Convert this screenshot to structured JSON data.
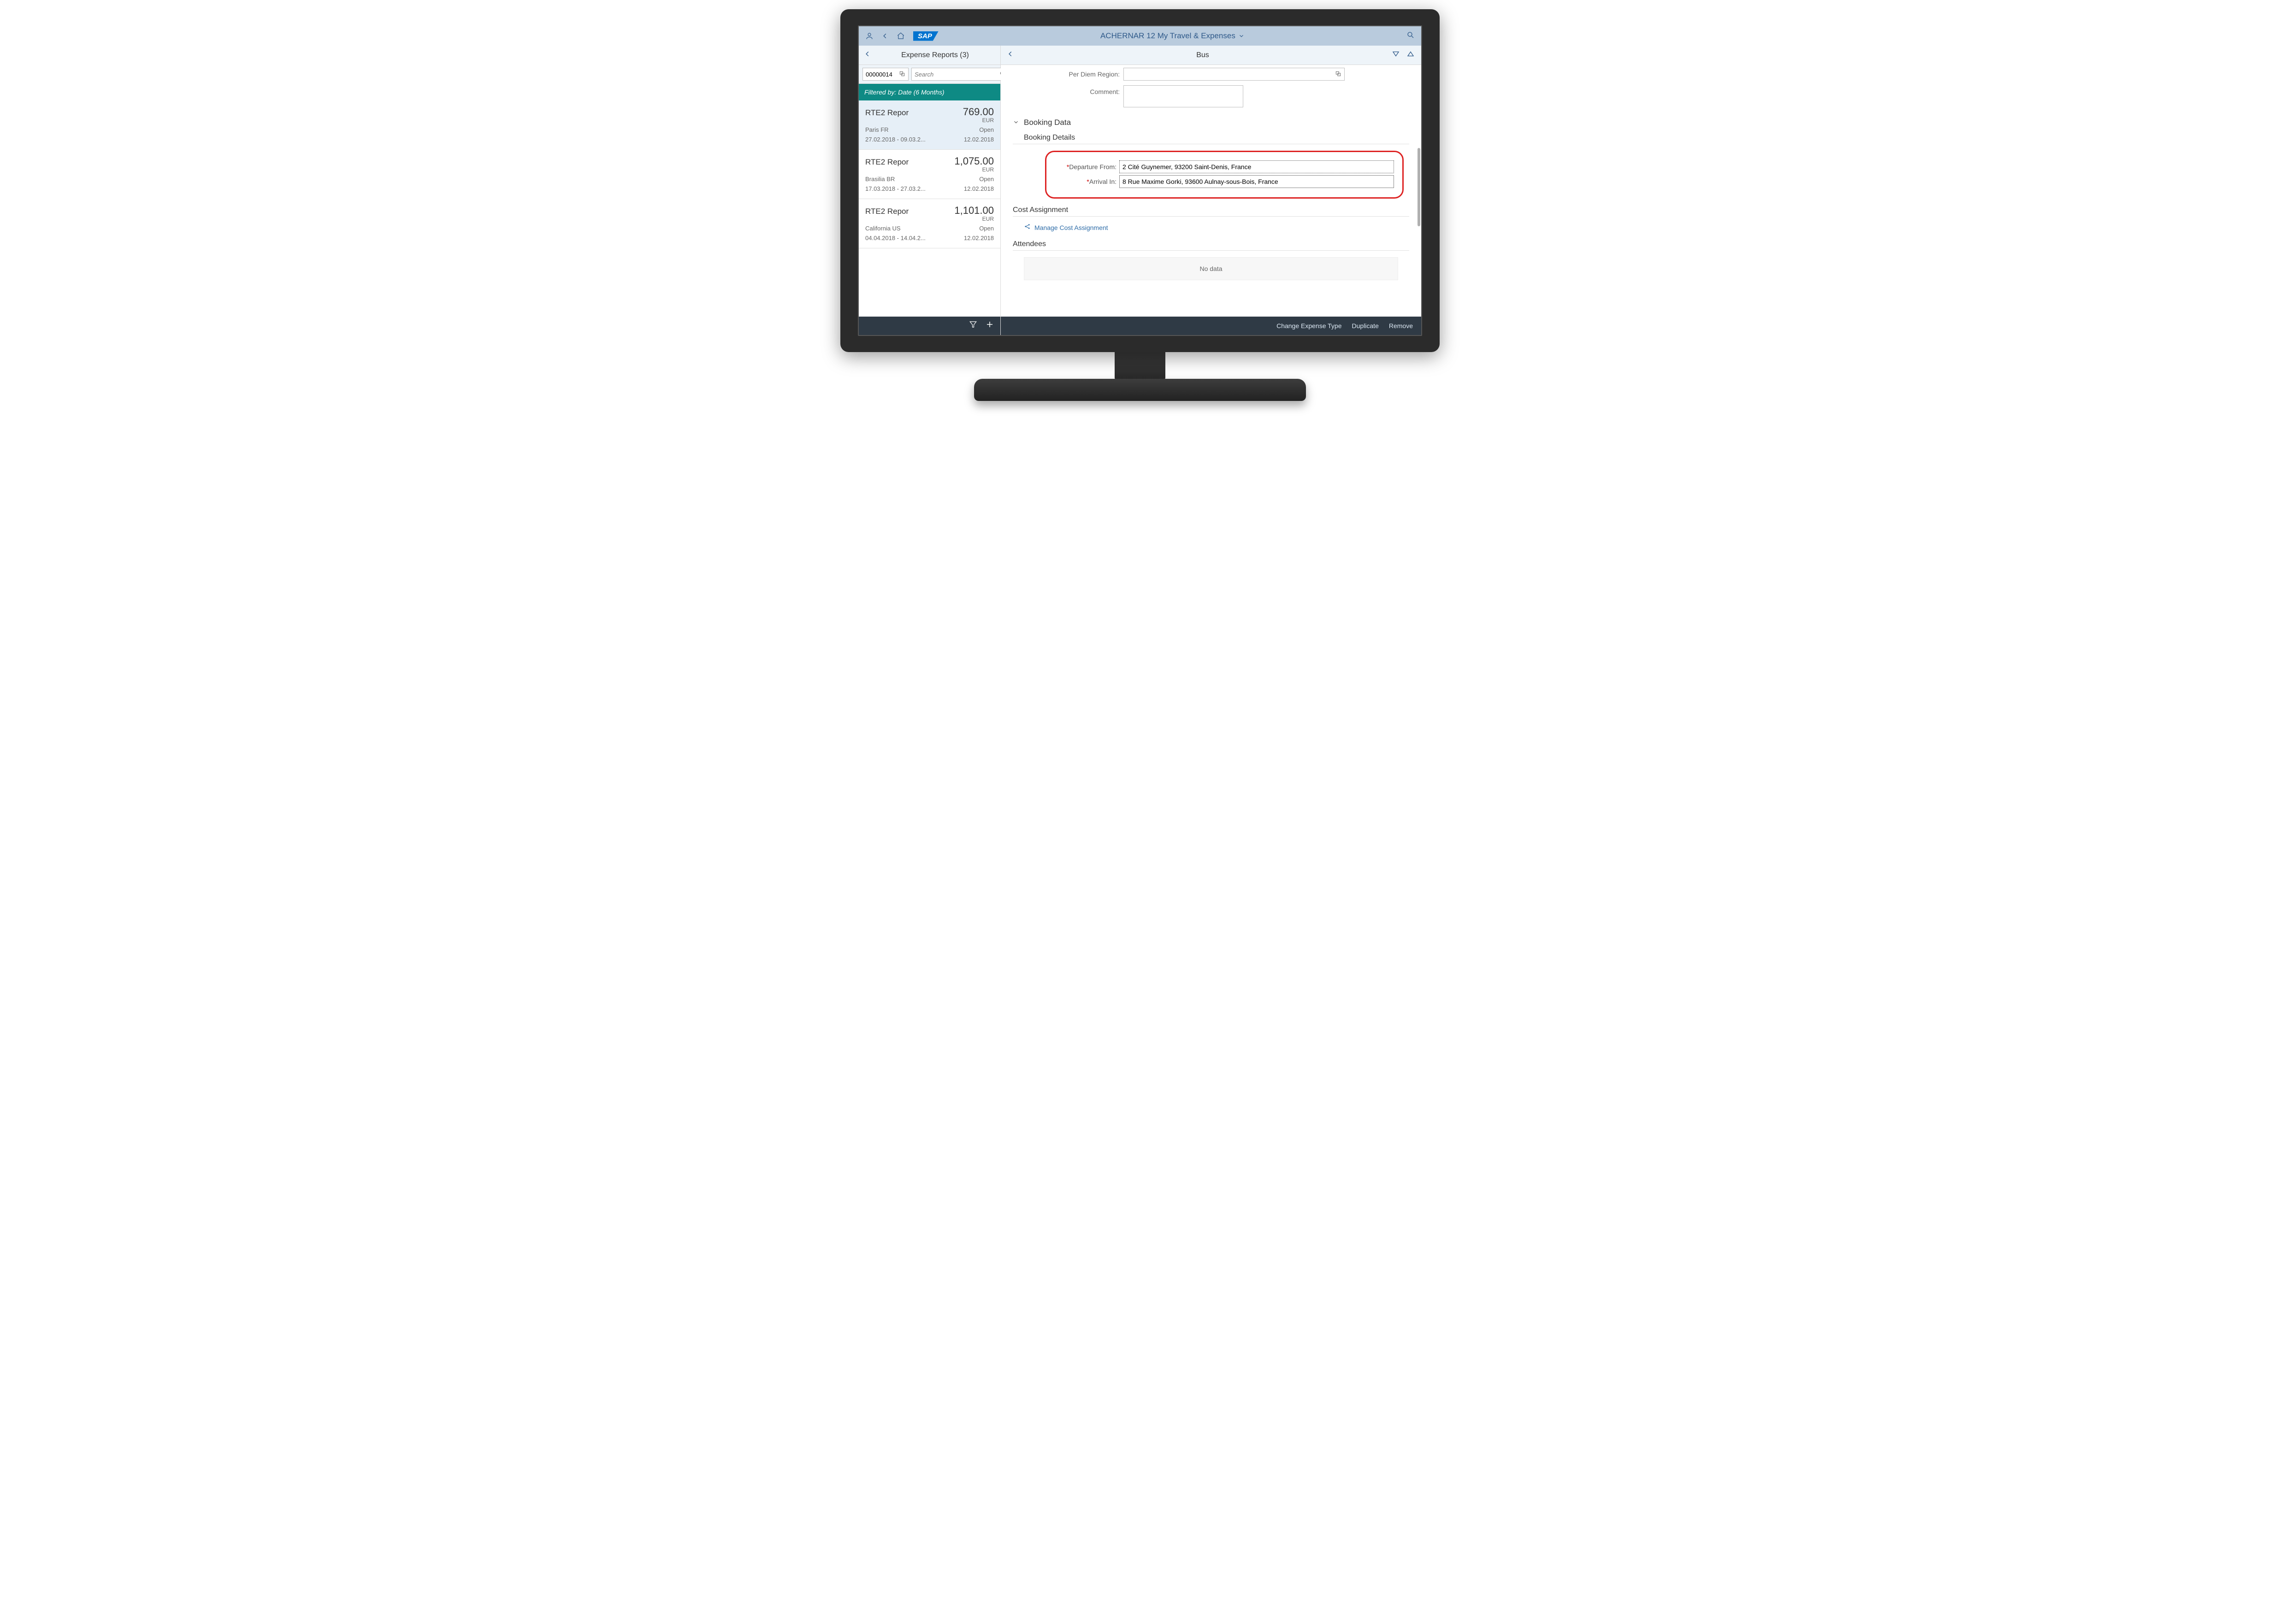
{
  "shell": {
    "title": "ACHERNAR 12 My Travel & Expenses"
  },
  "master": {
    "header": "Expense Reports (3)",
    "id_value": "00000014",
    "search_placeholder": "Search",
    "filter_banner": "Filtered by: Date (6 Months)",
    "items": [
      {
        "title": "RTE2 Repor",
        "amount": "769.00",
        "currency": "EUR",
        "location": "Paris FR",
        "status": "Open",
        "dates": "27.02.2018 - 09.03.2...",
        "created": "12.02.2018"
      },
      {
        "title": "RTE2 Repor",
        "amount": "1,075.00",
        "currency": "EUR",
        "location": "Brasilia BR",
        "status": "Open",
        "dates": "17.03.2018 - 27.03.2...",
        "created": "12.02.2018"
      },
      {
        "title": "RTE2 Repor",
        "amount": "1,101.00",
        "currency": "EUR",
        "location": "California US",
        "status": "Open",
        "dates": "04.04.2018 - 14.04.2...",
        "created": "12.02.2018"
      }
    ]
  },
  "detail": {
    "title": "Bus",
    "per_diem_label": "Per Diem Region:",
    "per_diem_value": "",
    "comment_label": "Comment:",
    "comment_value": "",
    "sections": {
      "booking_data": "Booking Data",
      "booking_details": "Booking Details",
      "cost_assignment": "Cost Assignment",
      "attendees": "Attendees"
    },
    "departure_label": "Departure From:",
    "departure_value": "2 Cité Guynemer, 93200 Saint-Denis, France",
    "arrival_label": "Arrival In:",
    "arrival_value": "8 Rue Maxime Gorki, 93600 Aulnay-sous-Bois, France",
    "manage_cost": "Manage Cost Assignment",
    "no_data": "No data",
    "footer": {
      "change_type": "Change Expense Type",
      "duplicate": "Duplicate",
      "remove": "Remove"
    }
  }
}
